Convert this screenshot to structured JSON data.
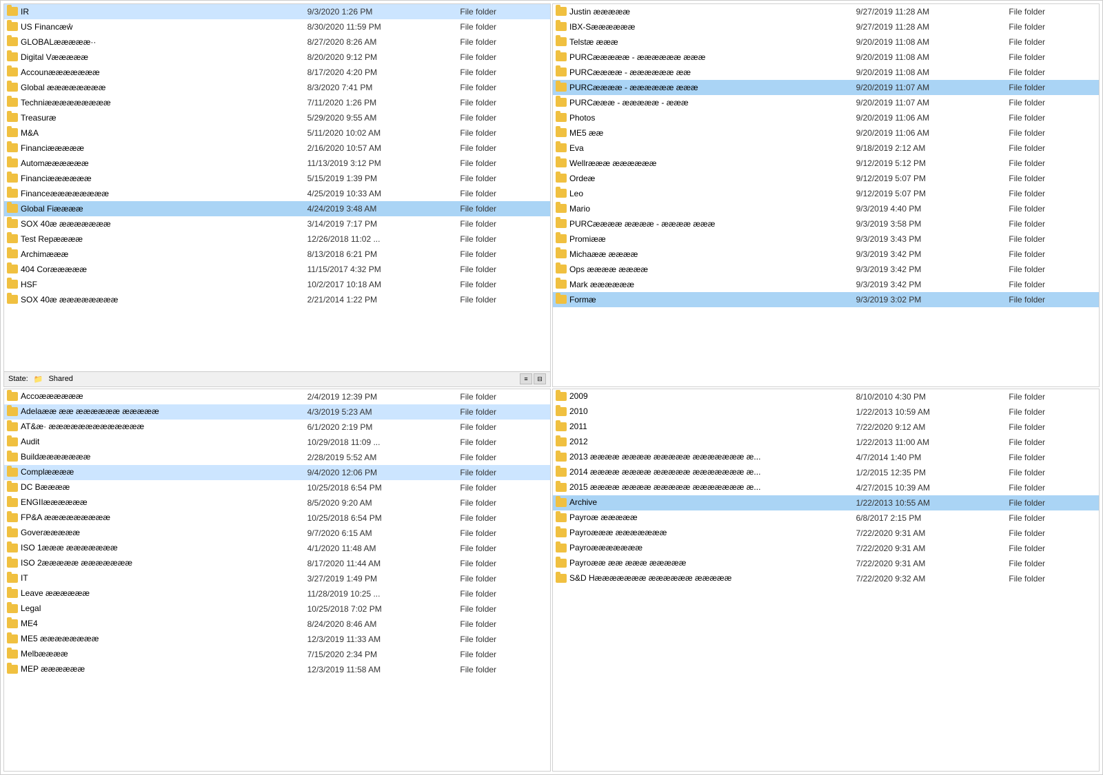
{
  "panes": {
    "top_left": {
      "items": [
        {
          "name": "IR",
          "date": "9/3/2020 1:26 PM",
          "type": "File folder",
          "selected": true
        },
        {
          "name": "US Financæŵ",
          "date": "8/30/2020 11:59 PM",
          "type": "File folder"
        },
        {
          "name": "GLOBALæææææ··",
          "date": "8/27/2020 8:26 AM",
          "type": "File folder"
        },
        {
          "name": "Digital Væææææ",
          "date": "8/20/2020 9:12 PM",
          "type": "File folder"
        },
        {
          "name": "Accounæææææææ",
          "date": "8/17/2020 4:20 PM",
          "type": "File folder"
        },
        {
          "name": "Global ææææææææ",
          "date": "8/3/2020 7:41 PM",
          "type": "File folder"
        },
        {
          "name": "Techniæææææææææ",
          "date": "7/11/2020 1:26 PM",
          "type": "File folder"
        },
        {
          "name": "Treasuræ",
          "date": "5/29/2020 9:55 AM",
          "type": "File folder"
        },
        {
          "name": "M&A",
          "date": "5/11/2020 10:02 AM",
          "type": "File folder"
        },
        {
          "name": "Financiæææææ",
          "date": "2/16/2020 10:57 AM",
          "type": "File folder"
        },
        {
          "name": "Automææææææ",
          "date": "11/13/2019 3:12 PM",
          "type": "File folder"
        },
        {
          "name": "Financiææææææ",
          "date": "5/15/2019 1:39 PM",
          "type": "File folder"
        },
        {
          "name": "Financeææææææææ",
          "date": "4/25/2019 10:33 AM",
          "type": "File folder"
        },
        {
          "name": "Global Fiææææ",
          "date": "4/24/2019 3:48 AM",
          "type": "File folder",
          "selected_dark": true
        },
        {
          "name": "SOX 40æ æææææææ",
          "date": "3/14/2019 7:17 PM",
          "type": "File folder"
        },
        {
          "name": "Test Repææææ",
          "date": "12/26/2018 11:02 ...",
          "type": "File folder"
        },
        {
          "name": "Archimæææ",
          "date": "8/13/2018 6:21 PM",
          "type": "File folder"
        },
        {
          "name": "404 Coræææææ",
          "date": "11/15/2017 4:32 PM",
          "type": "File folder"
        },
        {
          "name": "HSF",
          "date": "10/2/2017 10:18 AM",
          "type": "File folder"
        },
        {
          "name": "SOX 40æ ææææææææ",
          "date": "2/21/2014 1:22 PM",
          "type": "File folder"
        }
      ],
      "status": "State: 📂 Shared"
    },
    "top_right": {
      "items": [
        {
          "name": "Justin æææææ",
          "date": "9/27/2019 11:28 AM",
          "type": "File folder"
        },
        {
          "name": "IBX-Sææææææ",
          "date": "9/27/2019 11:28 AM",
          "type": "File folder"
        },
        {
          "name": "Telstæ æææ",
          "date": "9/20/2019 11:08 AM",
          "type": "File folder"
        },
        {
          "name": "PURCæææææ - ææææææ æææ",
          "date": "9/20/2019 11:08 AM",
          "type": "File folder"
        },
        {
          "name": "PURCææææ - ææææææ ææ",
          "date": "9/20/2019 11:08 AM",
          "type": "File folder"
        },
        {
          "name": "PURCææææ - ææææææ æææ",
          "date": "9/20/2019 11:07 AM",
          "type": "File folder",
          "selected_dark": true
        },
        {
          "name": "PURCæææ - æææææ - æææ",
          "date": "9/20/2019 11:07 AM",
          "type": "File folder"
        },
        {
          "name": "Photos",
          "date": "9/20/2019 11:06 AM",
          "type": "File folder"
        },
        {
          "name": "ME5 ææ",
          "date": "9/20/2019 11:06 AM",
          "type": "File folder"
        },
        {
          "name": "Eva",
          "date": "9/18/2019 2:12 AM",
          "type": "File folder"
        },
        {
          "name": "Wellræææ ææææææ",
          "date": "9/12/2019 5:12 PM",
          "type": "File folder"
        },
        {
          "name": "Ordeæ",
          "date": "9/12/2019 5:07 PM",
          "type": "File folder"
        },
        {
          "name": "Leo",
          "date": "9/12/2019 5:07 PM",
          "type": "File folder"
        },
        {
          "name": "Mario",
          "date": "9/3/2019 4:40 PM",
          "type": "File folder"
        },
        {
          "name": "PURCææææ ææææ - ææææ æææ",
          "date": "9/3/2019 3:58 PM",
          "type": "File folder"
        },
        {
          "name": "Promiææ",
          "date": "9/3/2019 3:43 PM",
          "type": "File folder"
        },
        {
          "name": "Michaææ ææææ",
          "date": "9/3/2019 3:42 PM",
          "type": "File folder"
        },
        {
          "name": "Ops ææææ ææææ",
          "date": "9/3/2019 3:42 PM",
          "type": "File folder"
        },
        {
          "name": "Mark ææææææ",
          "date": "9/3/2019 3:42 PM",
          "type": "File folder"
        },
        {
          "name": "Formæ",
          "date": "9/3/2019 3:02 PM",
          "type": "File folder",
          "selected_dark": true
        }
      ]
    },
    "bottom_left": {
      "items": [
        {
          "name": "Accoææææææ",
          "date": "2/4/2019 12:39 PM",
          "type": "File folder"
        },
        {
          "name": "Adelaææ ææ ææææææ æææææ",
          "date": "4/3/2019 5:23 AM",
          "type": "File folder",
          "selected": true
        },
        {
          "name": "AT&æ· æææææææææææææ",
          "date": "6/1/2020 2:19 PM",
          "type": "File folder"
        },
        {
          "name": "Audit",
          "date": "10/29/2018 11:09 ...",
          "type": "File folder"
        },
        {
          "name": "Buildæææææææ",
          "date": "2/28/2019 5:52 AM",
          "type": "File folder"
        },
        {
          "name": "Complææææ",
          "date": "9/4/2020 12:06 PM",
          "type": "File folder",
          "selected": true
        },
        {
          "name": "DC Bææææ",
          "date": "10/25/2018 6:54 PM",
          "type": "File folder"
        },
        {
          "name": "ENGIIææææææ",
          "date": "8/5/2020 9:20 AM",
          "type": "File folder"
        },
        {
          "name": "FP&A æææææææææ",
          "date": "10/25/2018 6:54 PM",
          "type": "File folder"
        },
        {
          "name": "Goveræææææ",
          "date": "9/7/2020 6:15 AM",
          "type": "File folder"
        },
        {
          "name": "ISO 1æææ æææææææ",
          "date": "4/1/2020 11:48 AM",
          "type": "File folder"
        },
        {
          "name": "ISO 2æææææ æææææææ",
          "date": "8/17/2020 11:44 AM",
          "type": "File folder"
        },
        {
          "name": "IT",
          "date": "3/27/2019 1:49 PM",
          "type": "File folder"
        },
        {
          "name": "Leave ææææææ",
          "date": "11/28/2019 10:25 ...",
          "type": "File folder"
        },
        {
          "name": "Legal",
          "date": "10/25/2018 7:02 PM",
          "type": "File folder"
        },
        {
          "name": "ME4",
          "date": "8/24/2020 8:46 AM",
          "type": "File folder"
        },
        {
          "name": "ME5 ææææææææ",
          "date": "12/3/2019 11:33 AM",
          "type": "File folder"
        },
        {
          "name": "Melbææææ",
          "date": "7/15/2020 2:34 PM",
          "type": "File folder"
        },
        {
          "name": "MEP ææææææ",
          "date": "12/3/2019 11:58 AM",
          "type": "File folder"
        }
      ]
    },
    "bottom_right": {
      "items": [
        {
          "name": "2009",
          "date": "8/10/2010 4:30 PM",
          "type": "File folder"
        },
        {
          "name": "2010",
          "date": "1/22/2013 10:59 AM",
          "type": "File folder"
        },
        {
          "name": "2011",
          "date": "7/22/2020 9:12 AM",
          "type": "File folder"
        },
        {
          "name": "2012",
          "date": "1/22/2013 11:00 AM",
          "type": "File folder"
        },
        {
          "name": "2013 ææææ ææææ æææææ æææææææ æ...",
          "date": "4/7/2014 1:40 PM",
          "type": "File folder"
        },
        {
          "name": "2014 ææææ ææææ æææææ æææææææ æ...",
          "date": "1/2/2015 12:35 PM",
          "type": "File folder"
        },
        {
          "name": "2015 ææææ ææææ æææææ æææææææ æ...",
          "date": "4/27/2015 10:39 AM",
          "type": "File folder"
        },
        {
          "name": "Archive",
          "date": "1/22/2013 10:55 AM",
          "type": "File folder",
          "selected_dark": true
        },
        {
          "name": "Payroæ æææææ",
          "date": "6/8/2017 2:15 PM",
          "type": "File folder"
        },
        {
          "name": "Payroæææ æææææææ",
          "date": "7/22/2020 9:31 AM",
          "type": "File folder"
        },
        {
          "name": "Payroæææææææ",
          "date": "7/22/2020 9:31 AM",
          "type": "File folder"
        },
        {
          "name": "Payroææ ææ æææ æææææ",
          "date": "7/22/2020 9:31 AM",
          "type": "File folder"
        },
        {
          "name": "S&D Hæææææææ ææææææ æææææ",
          "date": "7/22/2020 9:32 AM",
          "type": "File folder"
        }
      ]
    }
  },
  "labels": {
    "file_folder": "File folder",
    "state_shared": "State:",
    "shared_text": "Shared"
  }
}
